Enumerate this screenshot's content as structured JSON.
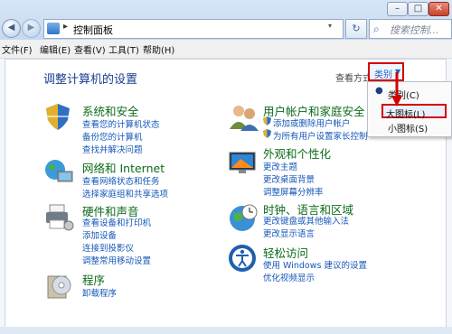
{
  "address": {
    "path": "控制面板",
    "separator": "▸"
  },
  "search": {
    "placeholder": "搜索控制..."
  },
  "window_controls": {
    "minimize": "–",
    "maximize": "□",
    "close": "✕"
  },
  "nav": {
    "back": "◀",
    "forward": "▶",
    "refresh": "↻",
    "dropdown": "▾"
  },
  "menu": [
    "文件(F)",
    "编辑(E)",
    "查看(V)",
    "工具(T)",
    "帮助(H)"
  ],
  "main": {
    "title": "调整计算机的设置",
    "view_by_label": "查看方式:",
    "view_by_value": "类别",
    "view_by_caret": "▼"
  },
  "dropdown": {
    "check": "●",
    "items": [
      "类别(C)",
      "大图标(L)",
      "小图标(S)"
    ]
  },
  "categories": [
    {
      "title": "系统和安全",
      "icon": "shield-icon",
      "links": [
        "查看您的计算机状态",
        "备份您的计算机",
        "查找并解决问题"
      ]
    },
    {
      "title": "网络和 Internet",
      "icon": "network-icon",
      "links": [
        "查看网络状态和任务",
        "选择家庭组和共享选项"
      ]
    },
    {
      "title": "硬件和声音",
      "icon": "printer-icon",
      "links": [
        "查看设备和打印机",
        "添加设备",
        "连接到投影仪",
        "调整常用移动设置"
      ]
    },
    {
      "title": "程序",
      "icon": "programs-icon",
      "links": [
        "卸载程序"
      ]
    },
    {
      "title": "用户帐户和家庭安全",
      "icon": "users-icon",
      "links": [
        "添加或删除用户帐户",
        "为所有用户设置家长控制"
      ]
    },
    {
      "title": "外观和个性化",
      "icon": "appearance-icon",
      "links": [
        "更改主题",
        "更改桌面背景",
        "调整屏幕分辨率"
      ]
    },
    {
      "title": "时钟、语言和区域",
      "icon": "clock-globe-icon",
      "links": [
        "更改键盘或其他输入法",
        "更改显示语言"
      ]
    },
    {
      "title": "轻松访问",
      "icon": "accessibility-icon",
      "links": [
        "使用 Windows 建议的设置",
        "优化视频显示"
      ]
    }
  ],
  "colors": {
    "title_green": "#0d6b1a",
    "link_blue": "#1557b8",
    "highlight_red": "#d40000"
  }
}
